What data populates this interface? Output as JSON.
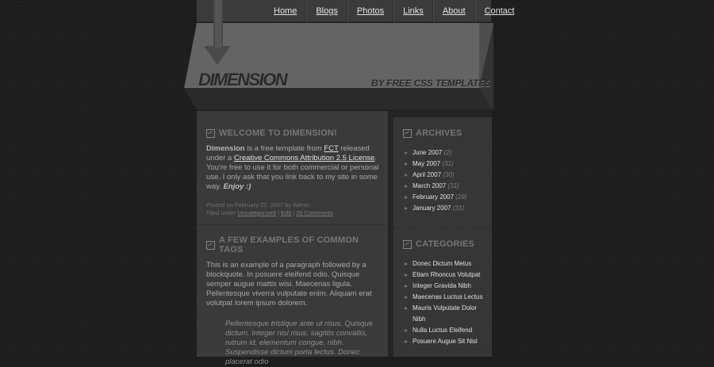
{
  "nav": {
    "items": [
      "Home",
      "Blogs",
      "Photos",
      "Links",
      "About",
      "Contact"
    ]
  },
  "header": {
    "logo": "DIMENSION",
    "tagline": "BY FREE CSS TEMPLATES"
  },
  "posts": [
    {
      "title": "WELCOME TO DIMENSION!",
      "body": {
        "name": "Dimension",
        "text1": " is a free template from ",
        "link1": "FCT",
        "text2": " released under a ",
        "link2": "Creative Commons Attribution 2.5 License",
        "text3": ". You're free to use it for both commercial or personal use. I only ask that you link back to my site in some way. ",
        "enjoy": "Enjoy :)"
      },
      "meta": {
        "posted": "Posted on February 22, 2007 by Admin",
        "filed_prefix": "Filed under ",
        "category": "Uncategorized",
        "sep1": " | ",
        "edit": "Edit",
        "sep2": " | ",
        "comments": "26 Comments"
      }
    },
    {
      "title": "A FEW EXAMPLES OF COMMON TAGS",
      "paragraph": "This is an example of a paragraph followed by a blockquote. In posuere eleifend odio. Quisque semper augue mattis wisi. Maecenas ligula. Pellentesque viverra vulputate enim. Aliquam erat volutpat lorem ipsum dolorem.",
      "quote": "Pellentesque tristique ante ut risus. Quisque dictum. Integer nisl risus, sagittis convallis, rutrum id, elementum congue, nibh. Suspendisse dictum porta lectus. Donec placerat odio"
    }
  ],
  "sidebar": {
    "archives_title": "ARCHIVES",
    "archives": [
      {
        "label": "June 2007",
        "count": "(2)"
      },
      {
        "label": "May 2007",
        "count": "(31)"
      },
      {
        "label": "April 2007",
        "count": "(30)"
      },
      {
        "label": "March 2007",
        "count": "(31)"
      },
      {
        "label": "February 2007",
        "count": "(28)"
      },
      {
        "label": "January 2007",
        "count": "(31)"
      }
    ],
    "categories_title": "CATEGORIES",
    "categories": [
      "Donec Dictum Metus",
      "Etiam Rhoncus Volutpat",
      "Integer Gravida Nibh",
      "Maecenas Luctus Lectus",
      "Mauris Vulputate Dolor Nibh",
      "Nulla Luctus Eleifend",
      "Posuere Augue Sit Nisl"
    ]
  },
  "colors": {
    "background": "#1e1e1e",
    "panel": "#3a3a3a",
    "link": "#e0e0e0"
  }
}
